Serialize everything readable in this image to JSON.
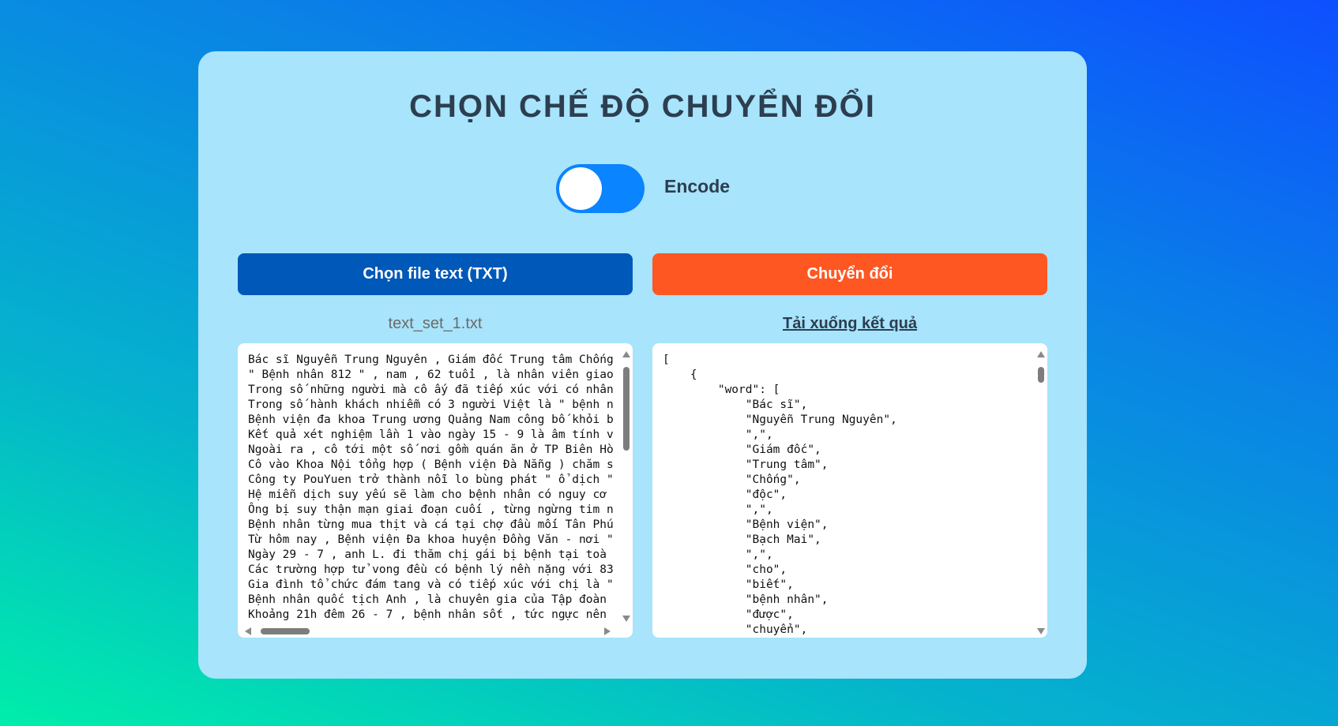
{
  "page": {
    "title": "CHỌN CHẾ ĐỘ CHUYỂN ĐỔI"
  },
  "mode_toggle": {
    "label": "Encode",
    "state": "on",
    "accent_color": "#0a84ff"
  },
  "buttons": {
    "choose_file_label": "Chọn file text (TXT)",
    "convert_label": "Chuyển đổi",
    "choose_color": "#0058b8",
    "convert_color": "#ff5722"
  },
  "input": {
    "filename": "text_set_1.txt",
    "content": "Bác sĩ Nguyễn Trung Nguyên , Giám đốc Trung tâm Chống\n\" Bệnh nhân 812 \" , nam , 62 tuổi , là nhân viên giao\nTrong số những người mà cô ấy đã tiếp xúc với có nhân\nTrong số hành khách nhiễm có 3 người Việt là \" bệnh n\nBệnh viện đa khoa Trung ương Quảng Nam công bố khỏi b\nKết quả xét nghiệm lần 1 vào ngày 15 - 9 là âm tính v\nNgoài ra , cô tới một số nơi gồm quán ăn ở TP Biên Hò\nCô vào Khoa Nội tổng hợp ( Bệnh viện Đà Nẵng ) chăm s\nCông ty PouYuen trở thành nỗi lo bùng phát \" ổ dịch \"\nHệ miễn dịch suy yếu sẽ làm cho bệnh nhân có nguy cơ\nÔng bị suy thận mạn giai đoạn cuối , từng ngừng tim n\nBệnh nhân từng mua thịt và cá tại chợ đầu mối Tân Phú\nTừ hôm nay , Bệnh viện Đa khoa huyện Đồng Văn - nơi \"\nNgày 29 - 7 , anh L. đi thăm chị gái bị bệnh tại toà\nCác trường hợp tử vong đều có bệnh lý nền nặng với 83\nGia đình tổ chức đám tang và có tiếp xúc với chị là \"\nBệnh nhân quốc tịch Anh , là chuyên gia của Tập đoàn\nKhoảng 21h đêm 26 - 7 , bệnh nhân sốt , tức ngực nên"
  },
  "output": {
    "download_label": "Tải xuống kết quả",
    "content": "[\n    {\n        \"word\": [\n            \"Bác sĩ\",\n            \"Nguyễn Trung Nguyên\",\n            \",\",\n            \"Giám đốc\",\n            \"Trung tâm\",\n            \"Chống\",\n            \"độc\",\n            \",\",\n            \"Bệnh viện\",\n            \"Bạch Mai\",\n            \",\",\n            \"cho\",\n            \"biết\",\n            \"bệnh nhân\",\n            \"được\",\n            \"chuyển\","
  }
}
